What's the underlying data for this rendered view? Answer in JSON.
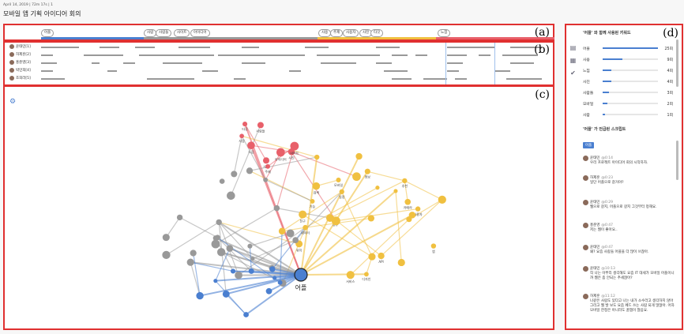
{
  "header": {
    "meta": "April 14, 2019 | 72m 17s | 1",
    "title": "모바일 앱 기획 아이디어 회의"
  },
  "panel_tags": {
    "a": "(a)",
    "b": "(b)",
    "c": "(c)",
    "d": "(d)"
  },
  "topics": {
    "pills": [
      "어플",
      "사람",
      "사람들",
      "사이트",
      "아이디어",
      "사용",
      "주제",
      "사용자",
      "사진",
      "타깃",
      "느낌"
    ],
    "colors": {
      "blue": "#4a7fd0",
      "gray": "#999999",
      "yellow": "#f0c040",
      "red": "#e8606a"
    }
  },
  "speakers": [
    "윤태민[1]",
    "허제훈[2]",
    "홍준영[3]",
    "박민희[4]",
    "조희라[5]"
  ],
  "keywords": {
    "title": "'어플' 와 함께 사용된 키워드",
    "items": [
      {
        "label": "어플",
        "count": "25회",
        "ratio": 1.0
      },
      {
        "label": "사용",
        "count": "9회",
        "ratio": 0.36
      },
      {
        "label": "느낌",
        "count": "4회",
        "ratio": 0.16
      },
      {
        "label": "사진",
        "count": "4회",
        "ratio": 0.16
      },
      {
        "label": "사람들",
        "count": "3회",
        "ratio": 0.12
      },
      {
        "label": "모바일",
        "count": "2회",
        "ratio": 0.08
      },
      {
        "label": "사람",
        "count": "1회",
        "ratio": 0.04
      }
    ]
  },
  "script": {
    "title": "'어플' 가 언급된 스크립트",
    "chip": "어플",
    "messages": [
      {
        "who": "윤태민",
        "time": "@0:14",
        "text": "우리 프로젝트 아이디어 회의 시작하자."
      },
      {
        "who": "허제훈",
        "time": "@0:23",
        "text": "일단 어플으로 갈거야?"
      },
      {
        "who": "윤태민",
        "time": "@0:29",
        "text": "웹으로 갈지, 어플으로 갈지 그것부터 정해요."
      },
      {
        "who": "홍준영",
        "time": "@0:47",
        "text": "저는 웹이 좋아요.."
      },
      {
        "who": "윤태민",
        "time": "@0:47",
        "text": "왜? 요즘 사람들 어플을 더 많이 쓰잖아."
      },
      {
        "who": "윤태민",
        "time": "@10:13",
        "text": "작 나는 이쭈리 생각해도 요즘 IT 대세가 모바일 어플이니까 웹은 좀 안되는 추세잖아?"
      },
      {
        "who": "허제훈",
        "time": "@11:12",
        "text": "나같은 사람도 있다고 나는 내가 소수라고 생각하지 않아 그리고 웹 발 보도 요즘 페드 쓰는 사람 되게 많잖아. 어차 모바일 한정은 아니라도 꿀잼이 많음요."
      }
    ]
  },
  "graph": {
    "center_label": "어플",
    "node_labels": [
      "사람",
      "사용",
      "사진",
      "느낌",
      "사람들",
      "주제",
      "타깃",
      "사이트",
      "아이디어",
      "API",
      "모바일",
      "사용자",
      "기능",
      "정보",
      "앱",
      "추천",
      "검색",
      "일정",
      "공유",
      "위치",
      "카메라",
      "친구",
      "데이터",
      "디자인",
      "서비스"
    ]
  }
}
